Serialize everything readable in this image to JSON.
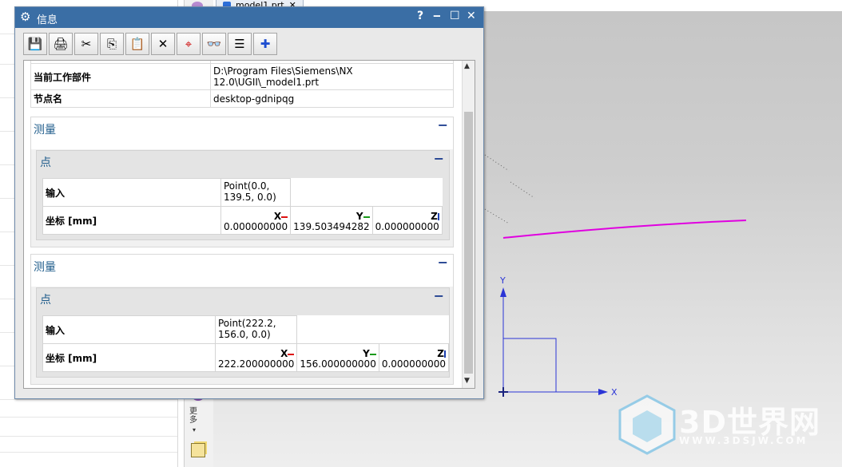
{
  "window": {
    "tab_label": "model1.prt",
    "tab_close": "✕"
  },
  "resource_bar": {
    "more_label": "更多"
  },
  "viewport": {
    "x_axis_label": "X",
    "y_axis_label": "Y",
    "curve_color": "#e000e0",
    "axis_color": "#2b35d6"
  },
  "watermark": {
    "text": "3D世界网",
    "url": "WWW.3DSJW.COM"
  },
  "dialog": {
    "title": "信息",
    "help": "?",
    "minimize": "‒",
    "maximize": "☐",
    "close": "✕",
    "toolbar": [
      {
        "name": "save-icon",
        "glyph": "💾"
      },
      {
        "name": "print-icon",
        "glyph": "🖨"
      },
      {
        "name": "cut-icon",
        "glyph": "✂"
      },
      {
        "name": "copy-icon",
        "glyph": "⎘"
      },
      {
        "name": "paste-icon",
        "glyph": "📋"
      },
      {
        "name": "delete-icon",
        "glyph": "✕"
      },
      {
        "name": "crosshair-icon",
        "glyph": "⌖"
      },
      {
        "name": "binoculars-icon",
        "glyph": "👓"
      },
      {
        "name": "wrap-icon",
        "glyph": "☰"
      },
      {
        "name": "add-icon",
        "glyph": "✚"
      }
    ],
    "info_rows": [
      {
        "key": "当前工作部件",
        "value": "D:\\Program Files\\Siemens\\NX 12.0\\UGII\\_model1.prt"
      },
      {
        "key": "节点名",
        "value": "desktop-gdnipqg"
      }
    ],
    "measures": [
      {
        "title": "测量",
        "collapse": "−",
        "point_title": "点",
        "point_collapse": "−",
        "input_label": "输入",
        "input_value": "Point(0.0, 139.5, 0.0)",
        "coord_label": "坐标 [mm]",
        "axes": [
          "X",
          "Y",
          "Z"
        ],
        "x": "0.000000000",
        "y": "139.503494282",
        "z": "0.000000000"
      },
      {
        "title": "测量",
        "collapse": "−",
        "point_title": "点",
        "point_collapse": "−",
        "input_label": "输入",
        "input_value": "Point(222.2, 156.0, 0.0)",
        "coord_label": "坐标 [mm]",
        "axes": [
          "X",
          "Y",
          "Z"
        ],
        "x": "222.200000000",
        "y": "156.000000000",
        "z": "0.000000000"
      }
    ]
  }
}
